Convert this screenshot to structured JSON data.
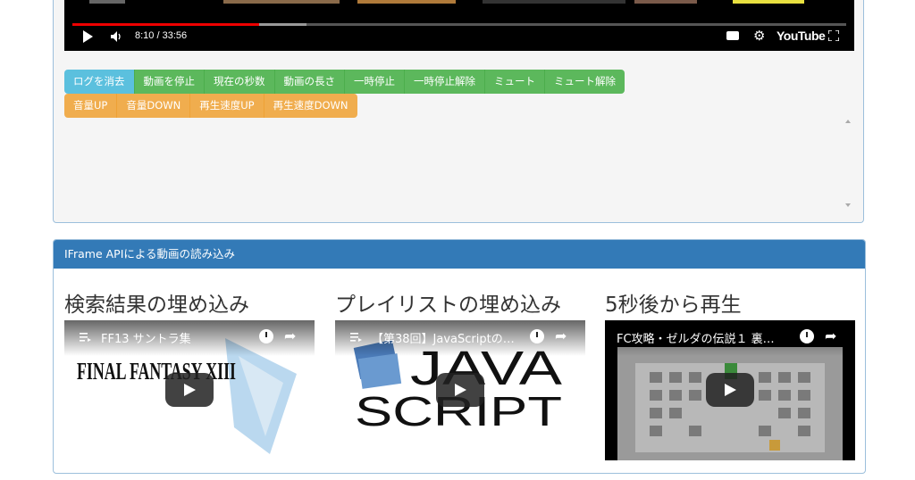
{
  "player": {
    "time": "8:10 / 33:56",
    "progress_played": 0.241,
    "progress_loaded": 0.302,
    "logo": "YouTube",
    "icons": [
      "play-icon",
      "volume-icon",
      "subtitles-icon",
      "settings-icon",
      "youtube-logo",
      "fullscreen-icon"
    ]
  },
  "controls": {
    "row1": [
      "ログを消去",
      "動画を停止",
      "現在の秒数",
      "動画の長さ",
      "一時停止",
      "一時停止解除",
      "ミュート",
      "ミュート解除"
    ],
    "row2": [
      "音量UP",
      "音量DOWN",
      "再生速度UP",
      "再生速度DOWN"
    ]
  },
  "panel": {
    "heading": "IFrame APIによる動画の読み込み",
    "columns": [
      {
        "heading": "検索結果の埋め込み",
        "video_title": "FF13 サントラ集",
        "thumb_text": "FINAL FANTASY XIII"
      },
      {
        "heading": "プレイリストの埋め込み",
        "video_title": "【第38回】JavaScriptの…",
        "thumb_text_1": "JAVA",
        "thumb_text_2": "SCRIPT"
      },
      {
        "heading": "5秒後から再生",
        "video_title": "FC攻略・ゼルダの伝説１ 裏…"
      }
    ]
  },
  "colors": {
    "info": "#5bc0de",
    "success": "#5cb85c",
    "warning": "#f0ad4e",
    "primary": "#337ab7",
    "youtube_red": "#ee0000"
  }
}
